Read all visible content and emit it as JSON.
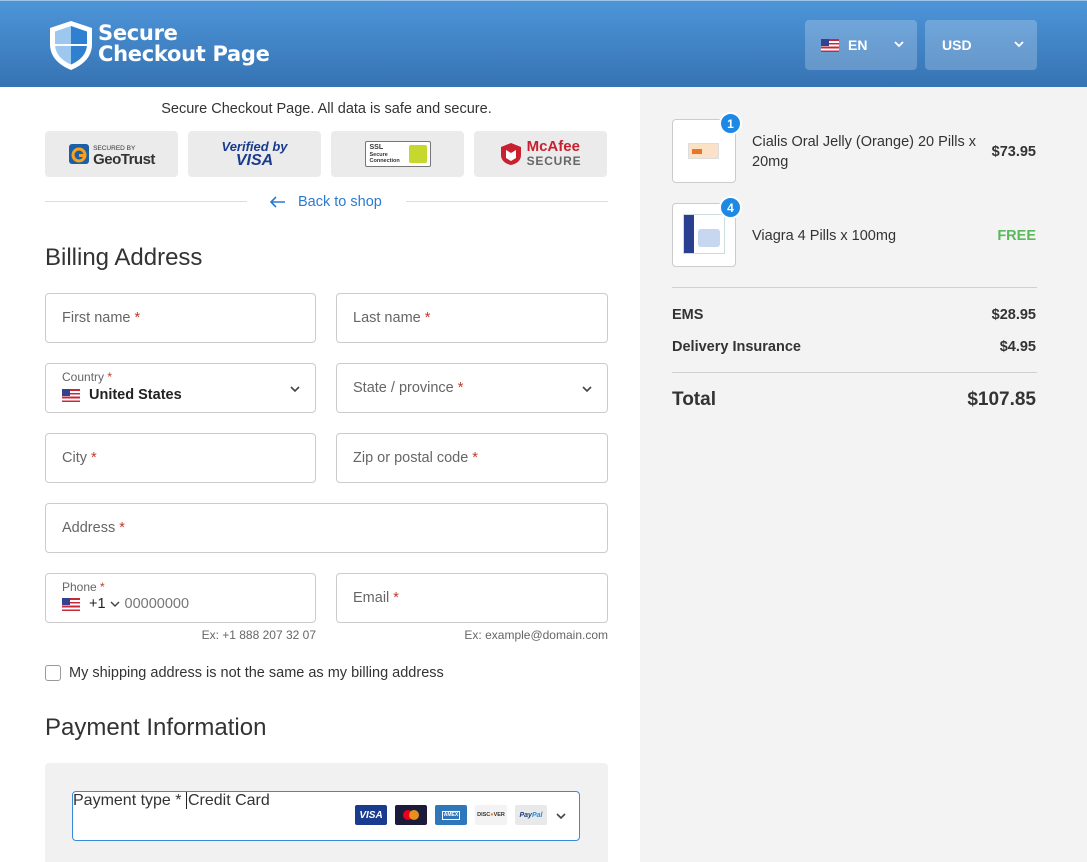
{
  "header": {
    "brand": "Secure Checkout Page",
    "language": "EN",
    "currency": "USD",
    "colors": {
      "top": "#4d95d9",
      "bottom": "#3673b3"
    }
  },
  "trust": {
    "notice": "Secure Checkout Page. All data is safe and secure.",
    "badges": [
      {
        "small": "SECURED BY",
        "name": "GeoTrust"
      },
      {
        "top": "Verified by",
        "name": "VISA"
      },
      {
        "lines": [
          "SSL",
          "Secure",
          "Connection"
        ]
      },
      {
        "name": "McAfee",
        "sub": "SECURE"
      }
    ],
    "back_link": "Back to shop"
  },
  "billing": {
    "title": "Billing Address",
    "first_name": "First name",
    "last_name": "Last name",
    "country_label": "Country",
    "country_value": "United States",
    "state": "State / province",
    "city": "City",
    "zip": "Zip or postal code",
    "address": "Address",
    "phone_label": "Phone",
    "phone_code": "+1",
    "phone_placeholder": "00000000",
    "phone_hint": "Ex: +1 888 207 32 07",
    "email": "Email",
    "email_hint": "Ex: example@domain.com",
    "required_mark": "*",
    "shipping_checkbox": "My shipping address is not the same as my billing address"
  },
  "payment": {
    "title": "Payment Information",
    "type_label": "Payment type",
    "type_value": "Credit Card",
    "cards": [
      "VISA",
      "MasterCard",
      "AMERICAN EXPRESS",
      "DISCOVER",
      "PayPal"
    ]
  },
  "order": {
    "items": [
      {
        "qty": "1",
        "name": "Cialis Oral Jelly (Orange) 20 Pills x 20mg",
        "price": "$73.95"
      },
      {
        "qty": "4",
        "name": "Viagra 4 Pills x 100mg",
        "price": "FREE"
      }
    ],
    "fees": [
      {
        "label": "EMS",
        "value": "$28.95"
      },
      {
        "label": "Delivery Insurance",
        "value": "$4.95"
      }
    ],
    "total_label": "Total",
    "total_value": "$107.85"
  }
}
